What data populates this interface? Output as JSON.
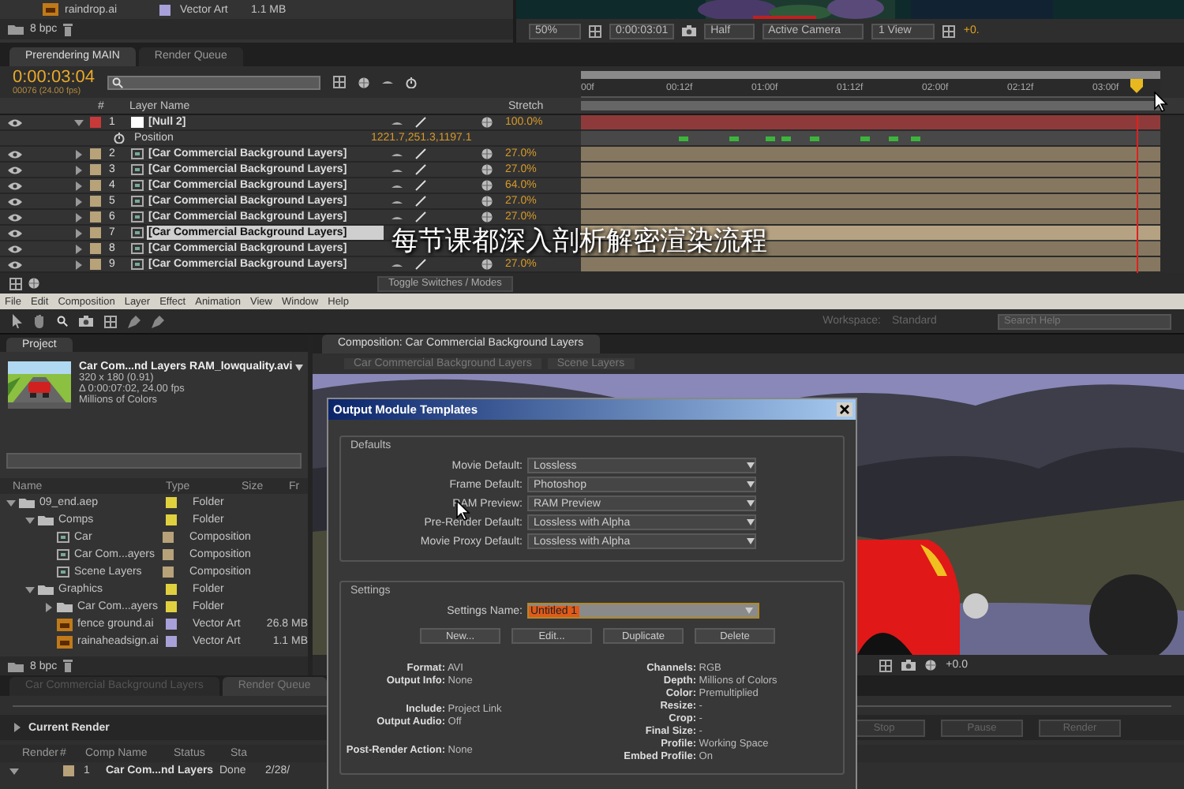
{
  "top_project_panel": {
    "rows": [
      {
        "name": "raindrop.ai",
        "type": "Vector Art",
        "size": "1.1 MB",
        "color": "#a8a0d8"
      }
    ],
    "bit_depth": "8 bpc"
  },
  "top_viewer": {
    "zoom": "50%",
    "timecode": "0:00:03:01",
    "resolution": "Half",
    "camera": "Active Camera",
    "views": "1 View",
    "exposure": "+0."
  },
  "timeline": {
    "tabs": [
      {
        "label": "Prerendering MAIN",
        "selected": true
      },
      {
        "label": "Render Queue",
        "selected": false
      }
    ],
    "timecode": "0:00:03:04",
    "frame_info": "00076 (24.00 fps)",
    "columns": {
      "number": "#",
      "layer_name": "Layer Name",
      "stretch": "Stretch"
    },
    "ruler": [
      "00f",
      "00:12f",
      "01:00f",
      "01:12f",
      "02:00f",
      "02:12f",
      "03:00f"
    ],
    "layers": [
      {
        "number": "1",
        "name": "[Null 2]",
        "kind": "null",
        "color": "#c83a3a",
        "stretch": "100.0%",
        "expanded": true,
        "selected": false,
        "properties": [
          {
            "name": "Position",
            "value": "1221.7,251.3,1197.1"
          }
        ]
      },
      {
        "number": "2",
        "name": "[Car Commercial Background Layers]",
        "kind": "comp",
        "color": "#b8a27a",
        "stretch": "27.0%",
        "expanded": false,
        "selected": false
      },
      {
        "number": "3",
        "name": "[Car Commercial Background Layers]",
        "kind": "comp",
        "color": "#b8a27a",
        "stretch": "27.0%",
        "expanded": false,
        "selected": false
      },
      {
        "number": "4",
        "name": "[Car Commercial Background Layers]",
        "kind": "comp",
        "color": "#b8a27a",
        "stretch": "64.0%",
        "expanded": false,
        "selected": false
      },
      {
        "number": "5",
        "name": "[Car Commercial Background Layers]",
        "kind": "comp",
        "color": "#b8a27a",
        "stretch": "27.0%",
        "expanded": false,
        "selected": false
      },
      {
        "number": "6",
        "name": "[Car Commercial Background Layers]",
        "kind": "comp",
        "color": "#b8a27a",
        "stretch": "27.0%",
        "expanded": false,
        "selected": false
      },
      {
        "number": "7",
        "name": "[Car Commercial Background Layers]",
        "kind": "comp",
        "color": "#b8a27a",
        "expanded": false,
        "selected": true,
        "switches_hidden": true
      },
      {
        "number": "8",
        "name": "[Car Commercial Background Layers]",
        "kind": "comp",
        "color": "#b8a27a",
        "expanded": false,
        "selected": false,
        "switches_hidden": true
      },
      {
        "number": "9",
        "name": "[Car Commercial Background Layers]",
        "kind": "comp",
        "color": "#b8a27a",
        "stretch": "27.0%",
        "expanded": false,
        "selected": false
      }
    ],
    "toggle_label": "Toggle Switches / Modes"
  },
  "caption": "每节课都深入剖析解密渲染流程",
  "menu": [
    "File",
    "Edit",
    "Composition",
    "Layer",
    "Effect",
    "Animation",
    "View",
    "Window",
    "Help"
  ],
  "toolbar": {
    "workspace_label": "Workspace:",
    "workspace": "Standard",
    "search_placeholder": "Search Help"
  },
  "project_panel": {
    "tab": "Project",
    "footage": {
      "name": "Car Com...nd Layers RAM_lowquality.avi",
      "details": [
        "320 x 180 (0.91)",
        "Δ 0:00:07:02, 24.00 fps",
        "Millions of Colors"
      ]
    },
    "columns": [
      "Name",
      "Type",
      "Size",
      "Fr"
    ],
    "items": [
      {
        "name": "09_end.aep",
        "kind": "folder",
        "type": "Folder",
        "color": "#e0d040",
        "expanded": true,
        "children": [
          {
            "name": "Comps",
            "kind": "folder",
            "type": "Folder",
            "color": "#e0d040",
            "expanded": true,
            "children": [
              {
                "name": "Car",
                "kind": "comp",
                "type": "Composition",
                "color": "#b8a27a"
              },
              {
                "name": "Car Com...ayers",
                "kind": "comp",
                "type": "Composition",
                "color": "#b8a27a"
              },
              {
                "name": "Scene Layers",
                "kind": "comp",
                "type": "Composition",
                "color": "#b8a27a"
              }
            ]
          },
          {
            "name": "Graphics",
            "kind": "folder",
            "type": "Folder",
            "color": "#e0d040",
            "expanded": true,
            "children": [
              {
                "name": "Car Com...ayers",
                "kind": "folder",
                "type": "Folder",
                "color": "#e0d040",
                "expanded": false
              },
              {
                "name": "fence ground.ai",
                "kind": "vector",
                "type": "Vector Art",
                "size": "26.8 MB",
                "color": "#a8a0d8"
              },
              {
                "name": "rainaheadsign.ai",
                "kind": "vector",
                "type": "Vector Art",
                "size": "1.1 MB",
                "color": "#a8a0d8"
              }
            ]
          }
        ]
      }
    ],
    "bit_depth": "8 bpc"
  },
  "comp_panel": {
    "tab": "Composition: Car Commercial Background Layers",
    "breadcrumbs": [
      "Car Commercial Background Layers",
      "Scene Layers"
    ],
    "exposure": "+0.0"
  },
  "render_queue": {
    "tabs": [
      {
        "label": "Car Commercial Background Layers",
        "selected": false
      },
      {
        "label": "Render Queue",
        "selected": true
      }
    ],
    "current_render": "Current Render",
    "buttons": [
      {
        "label": "Stop",
        "disabled": true
      },
      {
        "label": "Pause",
        "disabled": true
      },
      {
        "label": "Render",
        "disabled": true
      }
    ],
    "columns": [
      "Render",
      "#",
      "Comp Name",
      "Status",
      "Sta"
    ],
    "items": [
      {
        "number": "1",
        "comp_name": "Car Com...nd Layers",
        "status": "Done",
        "started": "2/28/",
        "color": "#b8a27a"
      }
    ]
  },
  "dialog": {
    "title": "Output Module Templates",
    "defaults_label": "Defaults",
    "defaults": [
      {
        "label": "Movie Default:",
        "value": "Lossless"
      },
      {
        "label": "Frame Default:",
        "value": "Photoshop"
      },
      {
        "label": "RAM Preview:",
        "value": "RAM Preview"
      },
      {
        "label": "Pre-Render Default:",
        "value": "Lossless with Alpha"
      },
      {
        "label": "Movie Proxy Default:",
        "value": "Lossless with Alpha"
      }
    ],
    "settings_label": "Settings",
    "settings_name": {
      "label": "Settings Name:",
      "value": "Untitled 1"
    },
    "buttons": [
      "New...",
      "Edit...",
      "Duplicate",
      "Delete"
    ],
    "info_left": [
      [
        "**Format:** AVI",
        "**Output Info:** None"
      ],
      [
        "**Include:** Project Link",
        "**Output Audio:** Off"
      ],
      [
        "**Post-Render Action:** None"
      ]
    ],
    "info_right": [
      [
        "**Channels:** RGB",
        "**Depth:** Millions of Colors",
        "**Color:** Premultiplied",
        "**Resize:** -",
        "**Crop:** -",
        "**Final Size:** -",
        "**Profile:** Working Space",
        "**Embed Profile:** On"
      ]
    ]
  }
}
